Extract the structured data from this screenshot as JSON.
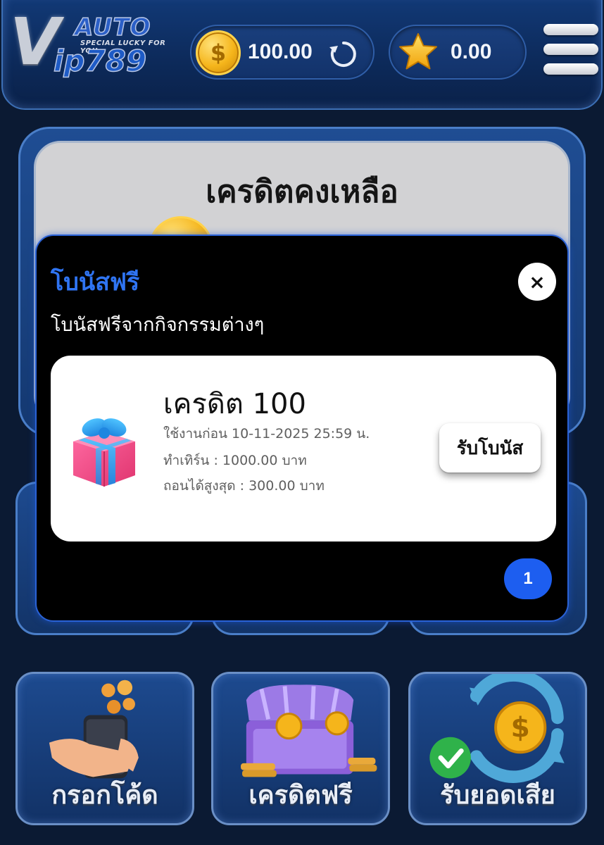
{
  "header": {
    "logo": {
      "v": "V",
      "auto": "AUTO",
      "tagline": "SPECIAL LUCKY FOR YOU",
      "ip": "ip789"
    },
    "credit_balance": "100.00",
    "point_balance": "0.00",
    "icons": {
      "coin": "dollar-coin-icon",
      "refresh": "refresh-icon",
      "star": "star-icon",
      "menu": "hamburger-menu-icon"
    }
  },
  "balance_card": {
    "title": "เครดิตคงเหลือ"
  },
  "modal": {
    "title": "โบนัสฟรี",
    "subtitle": "โบนัสฟรีจากกิจกรรมต่างๆ",
    "close_label": "×",
    "bonus": {
      "title": "เครดิต 100",
      "use_before": "ใช้งานก่อน 10-11-2025 25:59 น.",
      "turnover": "ทำเทิร์น : 1000.00 บาท",
      "max_withdraw": "ถอนได้สูงสุด : 300.00 บาท",
      "claim_label": "รับโบนัส"
    },
    "page": "1"
  },
  "tiles": [
    {
      "label": "กรอกโค้ด"
    },
    {
      "label": "เครดิตฟรี"
    },
    {
      "label": "รับยอดเสีย"
    }
  ],
  "colors": {
    "accent_blue": "#2f74f2",
    "badge_blue": "#1d5ef0",
    "header_bg": "#123a78",
    "page_bg": "#0b1a33"
  }
}
